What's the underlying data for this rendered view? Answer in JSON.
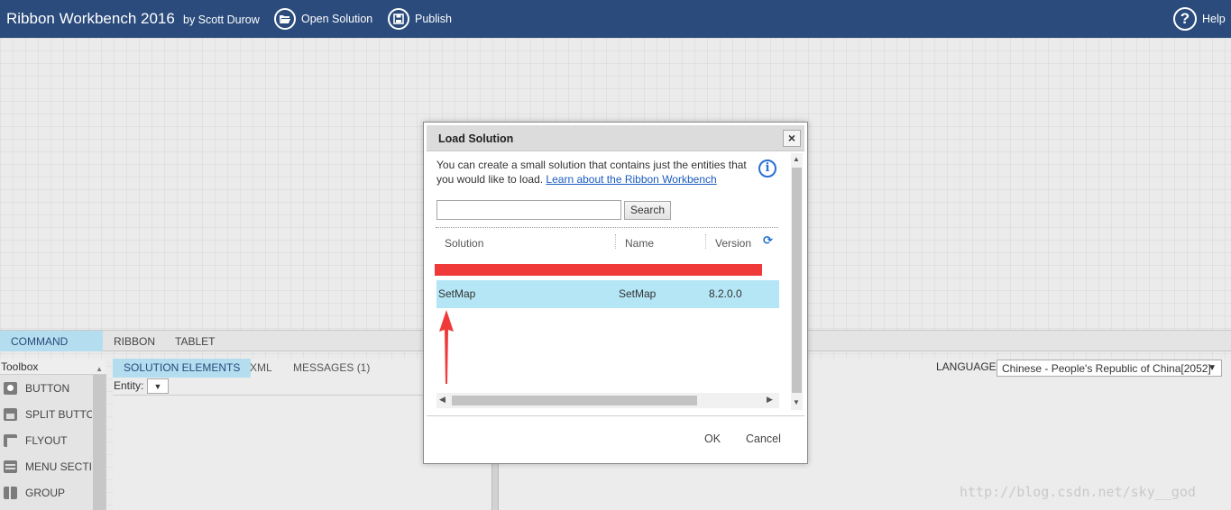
{
  "app": {
    "title": "Ribbon Workbench 2016",
    "author": "by Scott Durow"
  },
  "toolbar": {
    "open_label": "Open Solution",
    "publish_label": "Publish",
    "help_label": "Help"
  },
  "tabs": [
    "COMMAND BAR",
    "RIBBON",
    "TABLET"
  ],
  "toolbox": {
    "title": "Toolbox",
    "items": [
      {
        "label": "BUTTON",
        "icon": "button-icon"
      },
      {
        "label": "SPLIT BUTTON",
        "icon": "split-button-icon"
      },
      {
        "label": "FLYOUT",
        "icon": "flyout-icon"
      },
      {
        "label": "MENU SECTION",
        "icon": "menu-section-icon"
      },
      {
        "label": "GROUP",
        "icon": "group-icon"
      }
    ]
  },
  "main": {
    "tabs": [
      "SOLUTION ELEMENTS",
      "XML",
      "MESSAGES (1)"
    ],
    "entity_label": "Entity:",
    "language_label": "LANGUAGE:",
    "language_value": "Chinese - People's Republic of China[2052]"
  },
  "dialog": {
    "title": "Load Solution",
    "description": "You can create a small solution that contains just the entities that you would like to load.",
    "link": "Learn about the Ribbon Workbench",
    "search_value": "",
    "search_button": "Search",
    "columns": [
      "Solution",
      "Name",
      "Version"
    ],
    "rows": [
      {
        "solution": "SetMap",
        "name": "SetMap",
        "version": "8.2.0.0"
      }
    ],
    "ok": "OK",
    "cancel": "Cancel"
  },
  "watermark": "http://blog.csdn.net/sky__god",
  "colors": {
    "topbar": "#2a4b7c",
    "selected_tab": "#b4ddef",
    "selected_row": "#b4e6f5",
    "annotation_red": "#f03a3a",
    "link": "#1a5bbf"
  }
}
